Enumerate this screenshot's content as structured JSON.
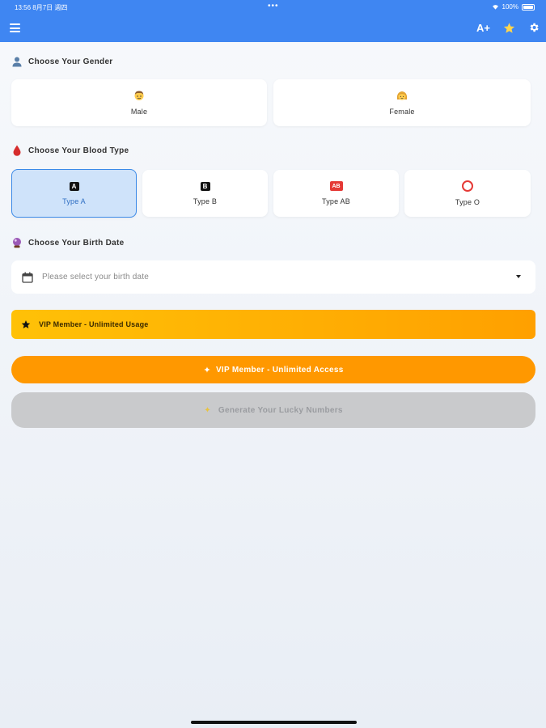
{
  "status_bar": {
    "time": "13:56  8月7日 週四",
    "dots": "•••",
    "battery_text": "100%"
  },
  "toolbar": {
    "font_size_label": "A+",
    "icons": [
      "menu-icon",
      "star-icon",
      "gear-icon"
    ],
    "bar_color": "#3f86f2"
  },
  "gender": {
    "title": "Choose Your Gender",
    "options": [
      {
        "label": "Male",
        "icon": "man-face-icon"
      },
      {
        "label": "Female",
        "icon": "woman-face-icon"
      }
    ]
  },
  "blood": {
    "title": "Choose Your Blood Type",
    "selected": "Type A",
    "options": [
      {
        "label": "Type A",
        "glyph": "A"
      },
      {
        "label": "Type B",
        "glyph": "B"
      },
      {
        "label": "Type AB",
        "glyph": "AB"
      },
      {
        "label": "Type O",
        "glyph": ""
      }
    ]
  },
  "birth": {
    "title": "Choose Your Birth Date",
    "placeholder": "Please select your birth date"
  },
  "vip_banner": {
    "text": "VIP Member - Unlimited Usage"
  },
  "vip_button": {
    "label": "VIP Member - Unlimited Access",
    "sparkle": "✦"
  },
  "generate_button": {
    "label": "Generate Your Lucky Numbers",
    "sparkle": "✦",
    "enabled": false
  },
  "colors": {
    "accent": "#3f86f2",
    "vip": "#ff9800",
    "selected_bg": "#cfe3fa"
  }
}
